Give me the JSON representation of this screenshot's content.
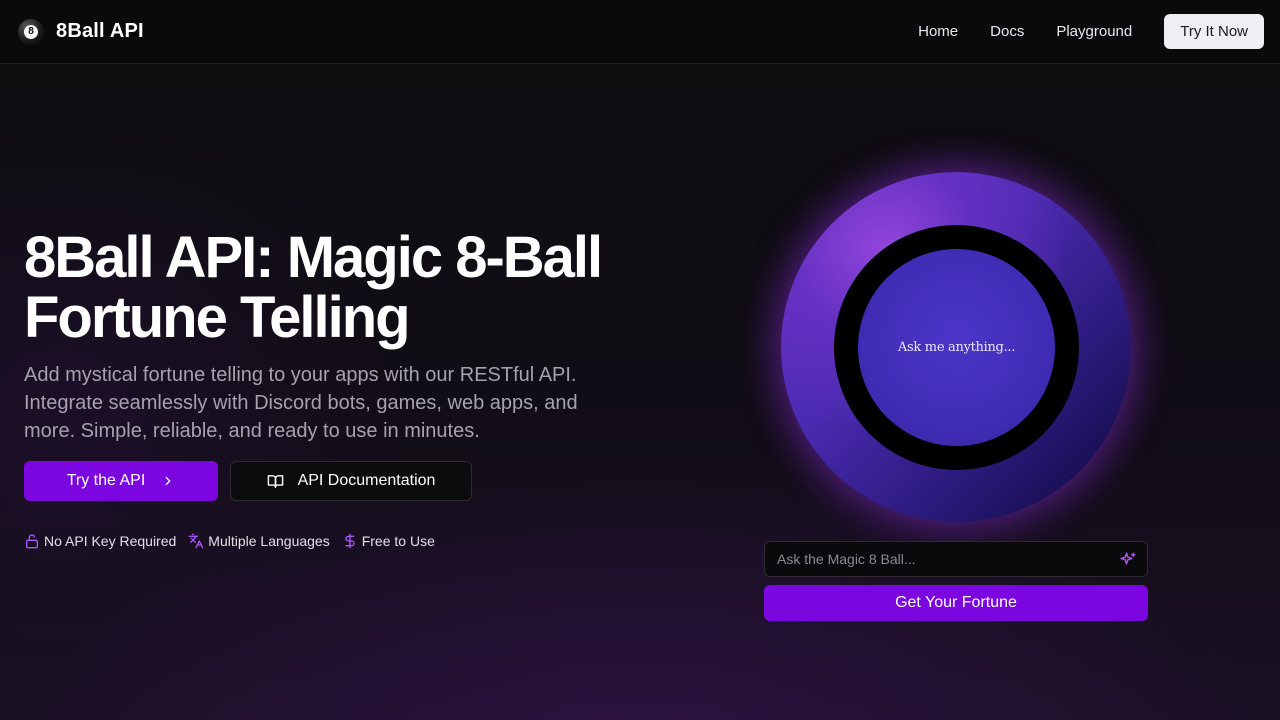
{
  "header": {
    "brand_name": "8Ball API",
    "logo_number": "8",
    "nav": [
      {
        "label": "Home"
      },
      {
        "label": "Docs"
      },
      {
        "label": "Playground"
      }
    ],
    "cta_label": "Try It Now"
  },
  "hero": {
    "title": "8Ball API: Magic 8-Ball Fortune Telling",
    "subtitle": "Add mystical fortune telling to your apps with our RESTful API. Integrate seamlessly with Discord bots, games, web apps, and more. Simple, reliable, and ready to use in minutes.",
    "primary_button": "Try the API",
    "secondary_button": "API Documentation",
    "features": [
      {
        "label": "No API Key Required",
        "icon": "lock-open-icon"
      },
      {
        "label": "Multiple Languages",
        "icon": "languages-icon"
      },
      {
        "label": "Free to Use",
        "icon": "dollar-icon"
      }
    ]
  },
  "ball": {
    "message": "Ask me anything..."
  },
  "fortune_form": {
    "placeholder": "Ask the Magic 8 Ball...",
    "value": "",
    "submit_label": "Get Your Fortune"
  },
  "colors": {
    "accent": "#7c06e0",
    "icon_accent": "#a855f7",
    "background": "#0b0a0d"
  }
}
